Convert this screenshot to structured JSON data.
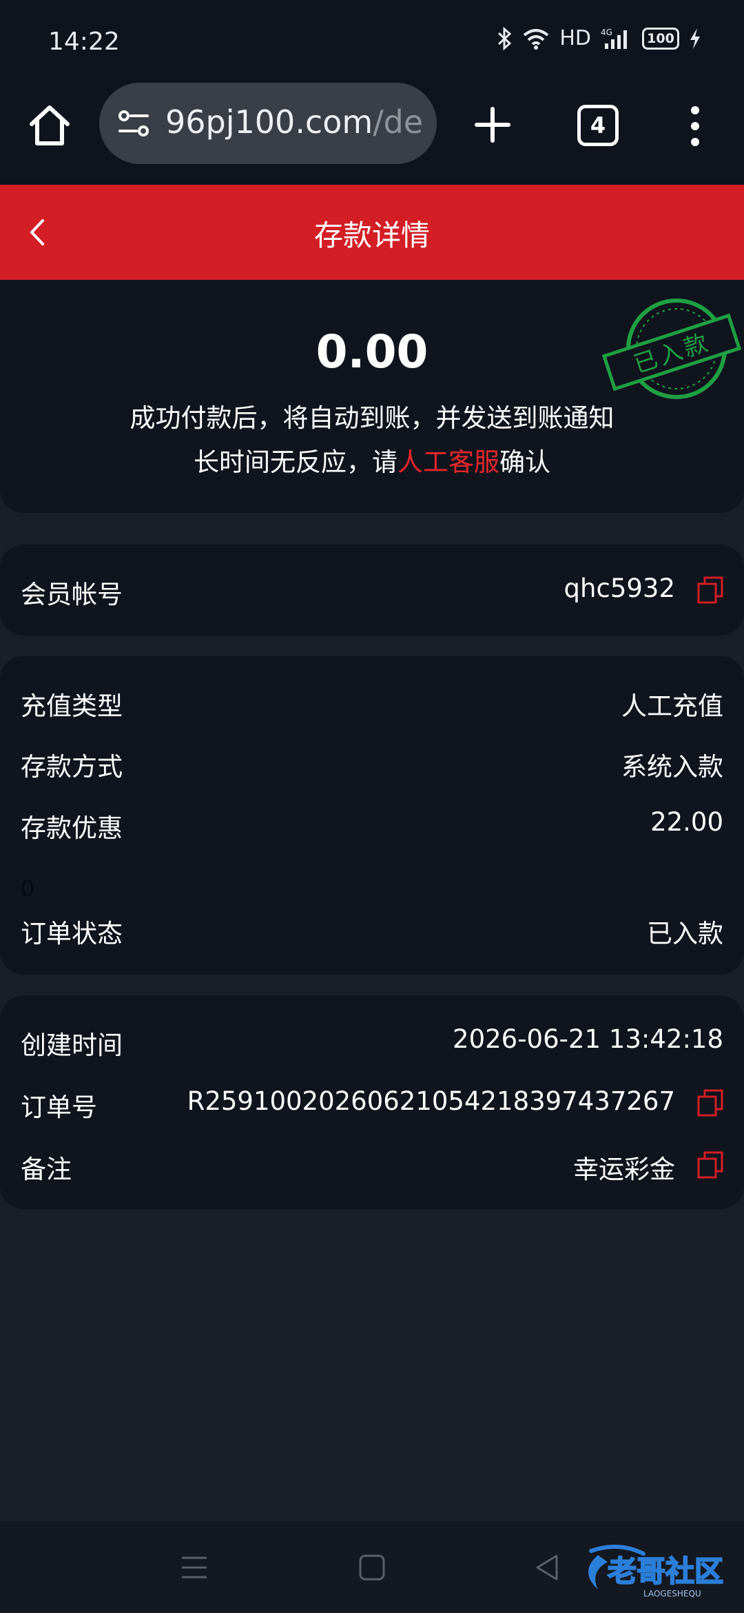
{
  "status_bar": {
    "time": "14:22",
    "network": "HD",
    "cell": "4G",
    "battery": "100"
  },
  "browser": {
    "url_host": "96pj100.com",
    "url_path": "/dep",
    "tab_count": "4"
  },
  "header": {
    "title": "存款详情"
  },
  "summary": {
    "amount": "0.00",
    "tip_line1": "成功付款后，将自动到账，并发送到账通知",
    "tip_line2_prefix": "长时间无反应，请",
    "tip_line2_link": "人工客服",
    "tip_line2_suffix": "确认",
    "stamp_text": "已入款"
  },
  "member": {
    "label": "会员帐号",
    "value": "qhc5932"
  },
  "deposit_info": {
    "recharge_type_label": "充值类型",
    "recharge_type_value": "人工充值",
    "method_label": "存款方式",
    "method_value": "系统入款",
    "bonus_label": "存款优惠",
    "bonus_value": "22.00",
    "stray_text": "0",
    "status_label": "订单状态",
    "status_value": "已入款"
  },
  "order_info": {
    "created_label": "创建时间",
    "created_value": "2026-06-21 13:42:18",
    "order_no_label": "订单号",
    "order_no_value": "R2591002026062105421839743726​7",
    "remark_label": "备注",
    "remark_value": "幸运彩金"
  },
  "watermark": {
    "main": "老哥社区",
    "sub": "LAOGESHEQU"
  },
  "colors": {
    "accent_red": "#d31e25",
    "stamp_green": "#1fa043",
    "background": "#191e28",
    "card": "#10141d"
  }
}
